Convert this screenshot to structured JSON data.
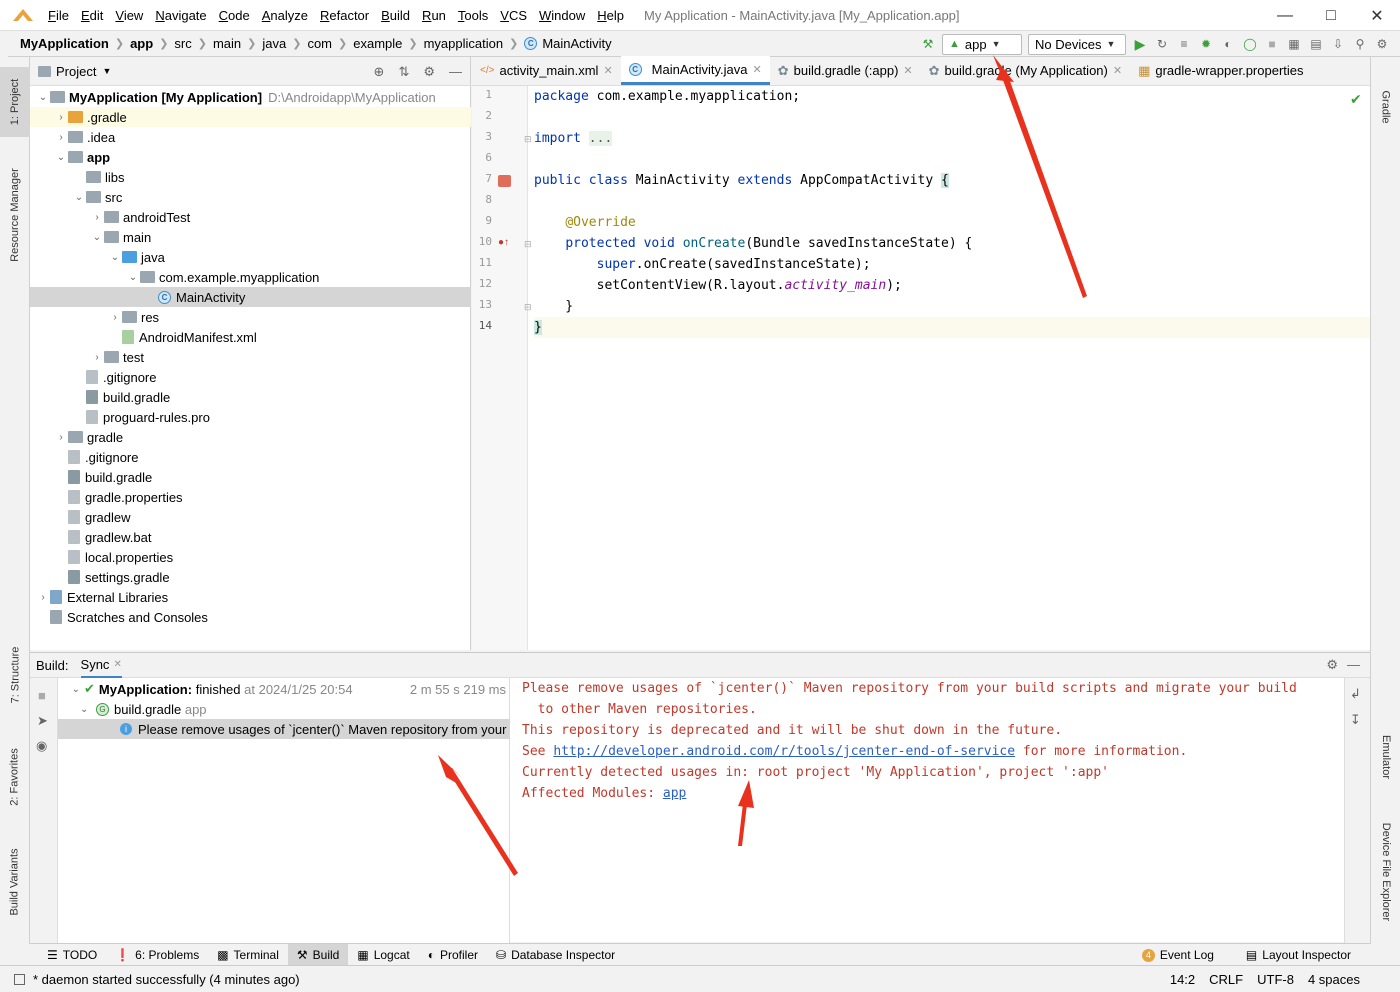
{
  "window": {
    "title": "My Application - MainActivity.java [My_Application.app]",
    "menu": [
      "File",
      "Edit",
      "View",
      "Navigate",
      "Code",
      "Analyze",
      "Refactor",
      "Build",
      "Run",
      "Tools",
      "VCS",
      "Window",
      "Help"
    ]
  },
  "breadcrumb": [
    "MyApplication",
    "app",
    "src",
    "main",
    "java",
    "com",
    "example",
    "myapplication",
    "MainActivity"
  ],
  "toolbar": {
    "run_config": "app",
    "device": "No Devices"
  },
  "project": {
    "header": "Project",
    "tree": [
      {
        "label": "MyApplication [My Application]",
        "extra": "D:\\Androidapp\\MyApplication",
        "depth": 0,
        "icon": "module"
      },
      {
        "label": ".gradle",
        "depth": 1,
        "icon": "folder-orange"
      },
      {
        "label": ".idea",
        "depth": 1,
        "icon": "folder"
      },
      {
        "label": "app",
        "depth": 1,
        "icon": "folder"
      },
      {
        "label": "libs",
        "depth": 2,
        "icon": "folder"
      },
      {
        "label": "src",
        "depth": 2,
        "icon": "folder"
      },
      {
        "label": "androidTest",
        "depth": 3,
        "icon": "folder"
      },
      {
        "label": "main",
        "depth": 3,
        "icon": "folder"
      },
      {
        "label": "java",
        "depth": 4,
        "icon": "folder-blue"
      },
      {
        "label": "com.example.myapplication",
        "depth": 5,
        "icon": "package"
      },
      {
        "label": "MainActivity",
        "depth": 6,
        "icon": "class"
      },
      {
        "label": "res",
        "depth": 4,
        "icon": "folder"
      },
      {
        "label": "AndroidManifest.xml",
        "depth": 4,
        "icon": "manifest"
      },
      {
        "label": "test",
        "depth": 3,
        "icon": "folder"
      },
      {
        "label": ".gitignore",
        "depth": 2,
        "icon": "file"
      },
      {
        "label": "build.gradle",
        "depth": 2,
        "icon": "gradle"
      },
      {
        "label": "proguard-rules.pro",
        "depth": 2,
        "icon": "file"
      },
      {
        "label": "gradle",
        "depth": 1,
        "icon": "folder"
      },
      {
        "label": ".gitignore",
        "depth": 1,
        "icon": "file"
      },
      {
        "label": "build.gradle",
        "depth": 1,
        "icon": "gradle"
      },
      {
        "label": "gradle.properties",
        "depth": 1,
        "icon": "file"
      },
      {
        "label": "gradlew",
        "depth": 1,
        "icon": "file"
      },
      {
        "label": "gradlew.bat",
        "depth": 1,
        "icon": "file"
      },
      {
        "label": "local.properties",
        "depth": 1,
        "icon": "file"
      },
      {
        "label": "settings.gradle",
        "depth": 1,
        "icon": "gradle"
      },
      {
        "label": "External Libraries",
        "depth": 0,
        "icon": "libs"
      },
      {
        "label": "Scratches and Consoles",
        "depth": 0,
        "icon": "scratch"
      }
    ]
  },
  "editor": {
    "tabs": [
      "activity_main.xml",
      "MainActivity.java",
      "build.gradle (:app)",
      "build.gradle (My Application)",
      "gradle-wrapper.properties"
    ],
    "line_numbers": [
      "1",
      "2",
      "3",
      "6",
      "7",
      "8",
      "9",
      "10",
      "11",
      "12",
      "13",
      "14"
    ]
  },
  "build": {
    "label": "Build:",
    "tab": "Sync",
    "rows": [
      {
        "title": "MyApplication:",
        "status": "finished",
        "when": "at 2024/1/25 20:54",
        "time": "2 m 55 s 219 ms"
      },
      {
        "title": "build.gradle",
        "sub": "app"
      },
      {
        "title": "Please remove usages of `jcenter()` Maven repository from your"
      }
    ],
    "output": [
      "Please remove usages of `jcenter()` Maven repository from your build scripts and migrate your build",
      "  to other Maven repositories.",
      "This repository is deprecated and it will be shut down in the future.",
      "Currently detected usages in: root project 'My Application', project ':app'"
    ],
    "see_prefix": "See ",
    "see_link": "http://developer.android.com/r/tools/jcenter-end-of-service",
    "see_suffix": " for more information.",
    "affected_prefix": "Affected Modules: ",
    "affected_link": "app"
  },
  "bottom_tabs": [
    "TODO",
    "6: Problems",
    "Terminal",
    "Build",
    "Logcat",
    "Profiler",
    "Database Inspector"
  ],
  "bottom_right": {
    "event_log": "Event Log",
    "event_count": "4",
    "layout_inspector": "Layout Inspector"
  },
  "status": {
    "message": "* daemon started successfully (4 minutes ago)",
    "position": "14:2",
    "line_sep": "CRLF",
    "encoding": "UTF-8",
    "indent": "4 spaces"
  },
  "side_tabs": {
    "left": [
      "1: Project",
      "Resource Manager",
      "7: Structure",
      "2: Favorites",
      "Build Variants"
    ],
    "right": [
      "Gradle",
      "Emulator",
      "Device File Explorer"
    ]
  },
  "colors": {
    "accent": "#4083c9",
    "error_text": "#c0392b",
    "arrow": "#e8321e",
    "run_green": "#3aa13a"
  }
}
